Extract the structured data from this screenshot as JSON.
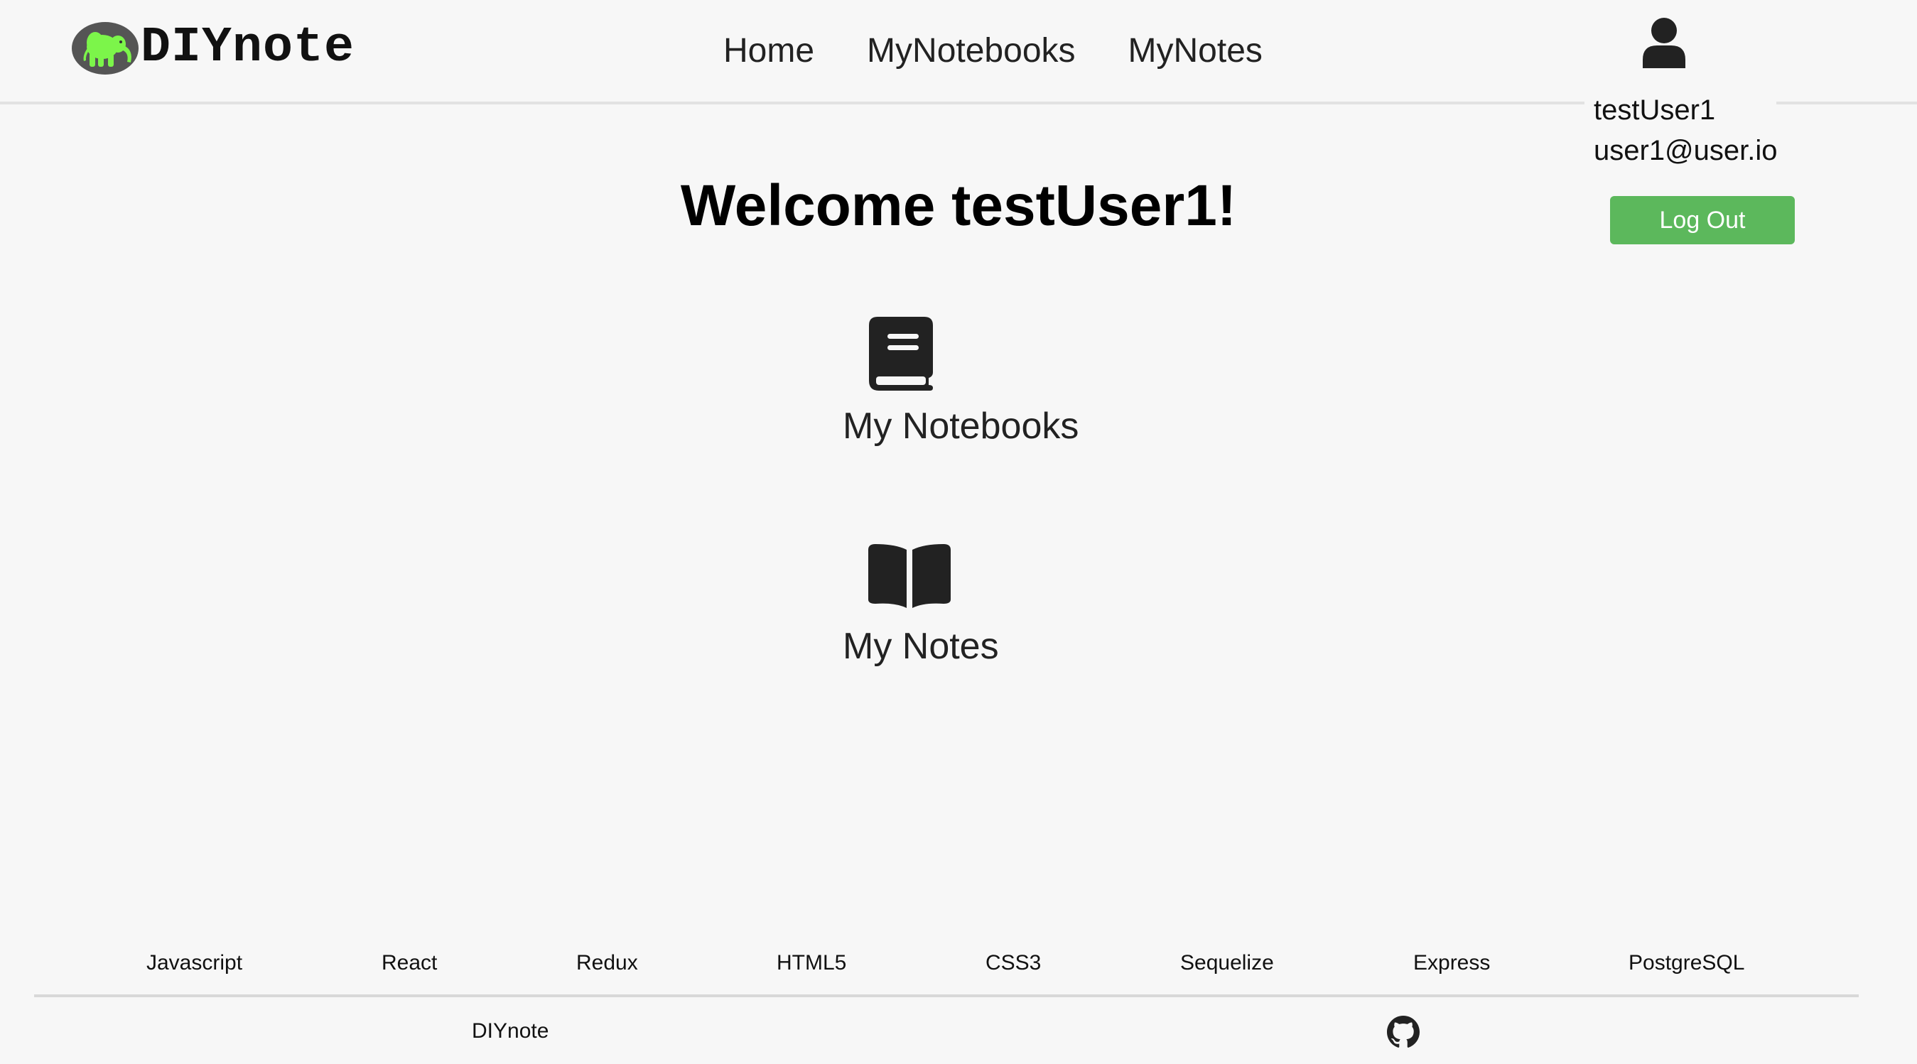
{
  "header": {
    "logo_text": "DIYnote",
    "logo_icon": "elephant-icon",
    "nav": {
      "home": "Home",
      "notebooks": "MyNotebooks",
      "notes": "MyNotes"
    }
  },
  "user": {
    "icon": "user-icon",
    "name": "testUser1",
    "email": "user1@user.io",
    "logout_label": "Log Out"
  },
  "main": {
    "welcome": "Welcome testUser1!",
    "tiles": [
      {
        "icon": "book-icon",
        "label": "My Notebooks"
      },
      {
        "icon": "book-open-icon",
        "label": "My Notes"
      }
    ]
  },
  "footer": {
    "tech": [
      "Javascript",
      "React",
      "Redux",
      "HTML5",
      "CSS3",
      "Sequelize",
      "Express",
      "PostgreSQL"
    ],
    "brand": "DIYnote",
    "github_icon": "github-icon"
  },
  "colors": {
    "background": "#f7f7f7",
    "logout_button": "#5cb85c",
    "logo_elephant": "#7cf54a",
    "logo_badge": "#555555",
    "text": "#222222"
  }
}
